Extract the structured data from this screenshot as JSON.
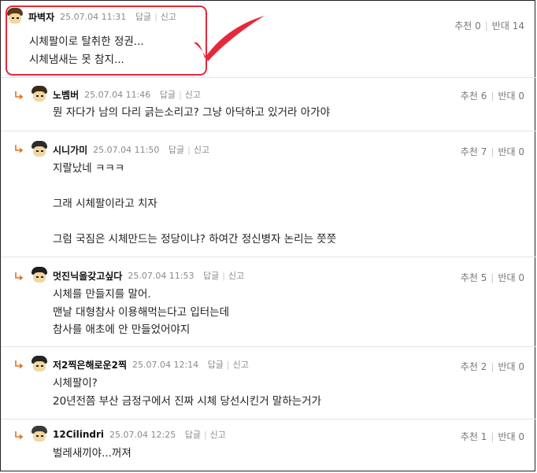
{
  "annotation": {
    "color": "#e6283a"
  },
  "comments": [
    {
      "nick": "파벽자",
      "date": "25.07.04 11:31",
      "reply": "답글",
      "report": "신고",
      "up_label": "추천",
      "up": "0",
      "down_label": "반대",
      "down": "14",
      "text": "시체팔이로 탈취한 정권...\n시체냄새는 못 참지..."
    },
    {
      "nick": "노벰버",
      "date": "25.07.04 11:46",
      "reply": "답글",
      "report": "신고",
      "up_label": "추천",
      "up": "6",
      "down_label": "반대",
      "down": "0",
      "text": "뭔 자다가 남의 다리 긁는소리고? 그냥 아닥하고 있거라 아가야"
    },
    {
      "nick": "시니가미",
      "date": "25.07.04 11:50",
      "reply": "답글",
      "report": "신고",
      "up_label": "추천",
      "up": "7",
      "down_label": "반대",
      "down": "0",
      "text": "지랄났네 ㅋㅋㅋ\n\n그래 시체팔이라고 치자\n\n그럼 국짐은 시체만드는 정당이냐? 하여간 정신병자 논리는 쯧쯧"
    },
    {
      "nick": "멋진닉을갖고싶다",
      "date": "25.07.04 11:53",
      "reply": "답글",
      "report": "신고",
      "up_label": "추천",
      "up": "5",
      "down_label": "반대",
      "down": "0",
      "text": "시체를 만들지를 말어.\n맨날 대형참사 이용해먹는다고 입터는데\n참사를 애초에 안 만들었어야지"
    },
    {
      "nick": "저2찍은해로운2찍",
      "date": "25.07.04 12:14",
      "reply": "답글",
      "report": "신고",
      "up_label": "추천",
      "up": "2",
      "down_label": "반대",
      "down": "0",
      "text": "시체팔이?\n20년전쯤 부산 금정구에서 진짜 시체 당선시킨거 말하는거가"
    },
    {
      "nick": "12Cilindri",
      "date": "25.07.04 12:25",
      "reply": "답글",
      "report": "신고",
      "up_label": "추천",
      "up": "1",
      "down_label": "반대",
      "down": "0",
      "text": "벌레새끼야...꺼져"
    }
  ]
}
